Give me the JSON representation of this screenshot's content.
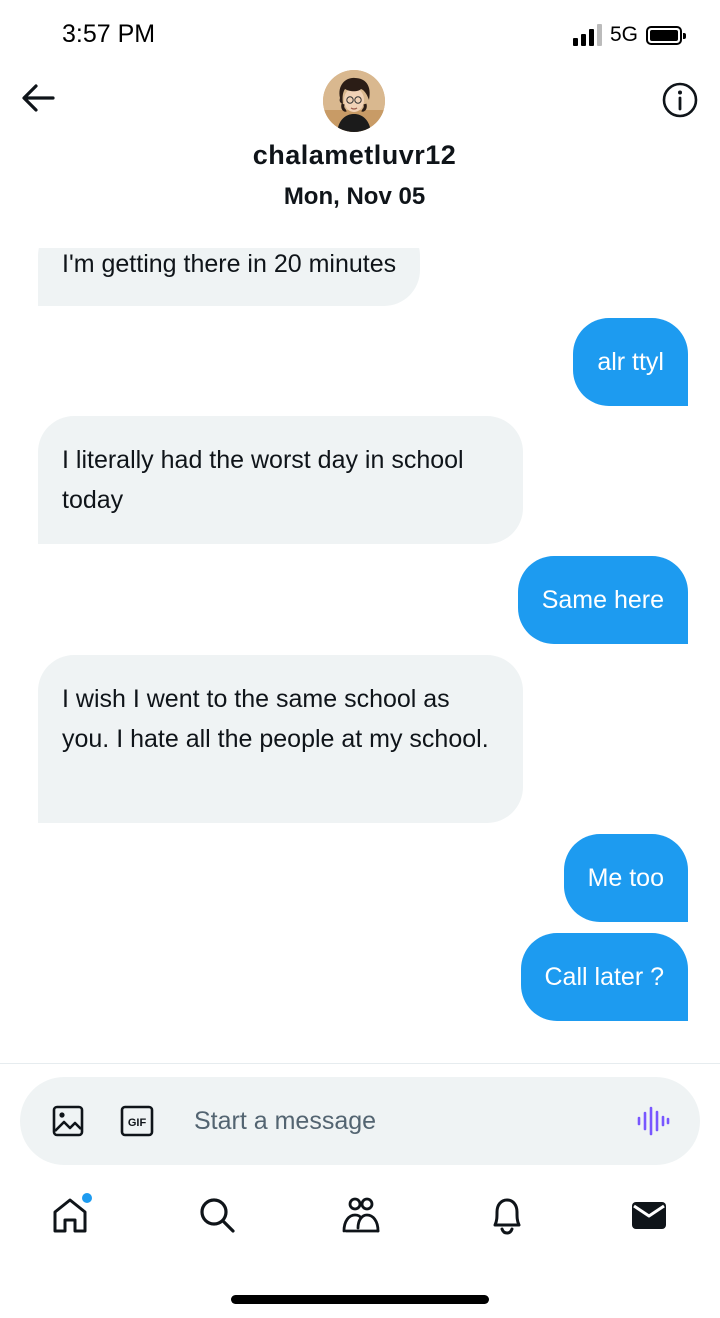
{
  "status_bar": {
    "time": "3:57 PM",
    "network": "5G",
    "icons": [
      "signal-icon",
      "battery-icon"
    ]
  },
  "header": {
    "username": "chalametluvr12",
    "date": "Mon, Nov 05",
    "icons": [
      "back-arrow-icon",
      "avatar",
      "info-icon"
    ]
  },
  "messages": [
    {
      "direction": "received",
      "text": "I'm getting there in 20 minutes"
    },
    {
      "direction": "sent",
      "text": "alr ttyl"
    },
    {
      "direction": "received",
      "text": "I literally had the worst day in school today"
    },
    {
      "direction": "sent",
      "text": "Same here"
    },
    {
      "direction": "received",
      "text": "I wish I went to the same school as you. I hate all the people at my school."
    },
    {
      "direction": "sent",
      "text": "Me too"
    },
    {
      "direction": "sent",
      "text": "Call later ?"
    }
  ],
  "composer": {
    "placeholder": "Start a message",
    "gif_label": "GIF",
    "icons": [
      "image-icon",
      "gif-icon",
      "voice-icon"
    ]
  },
  "nav": {
    "items": [
      "home-icon",
      "search-icon",
      "communities-icon",
      "notifications-icon",
      "messages-icon"
    ]
  },
  "colors": {
    "accent": "#1d9bf0",
    "received_bubble": "#eff3f4",
    "text": "#0f1419",
    "placeholder": "#536471",
    "voice": "#7856ff"
  }
}
